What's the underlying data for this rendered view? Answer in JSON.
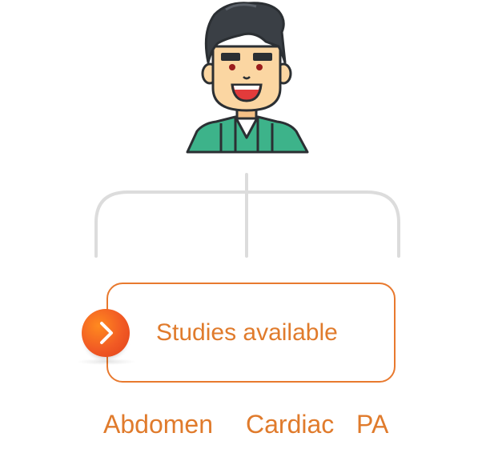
{
  "box": {
    "label": "Studies available"
  },
  "studies": [
    {
      "label": "Abdomen"
    },
    {
      "label": "Cardiac"
    },
    {
      "label": "PA"
    }
  ],
  "icons": {
    "avatar": "doctor-avatar-icon",
    "button": "chevron-right-icon"
  },
  "colors": {
    "accent": "#e8792e",
    "text": "#e07b2c",
    "connector": "#dcdcdc",
    "shirt": "#3db38a",
    "hair": "#3a3f45",
    "skin": "#fbd6a2"
  }
}
